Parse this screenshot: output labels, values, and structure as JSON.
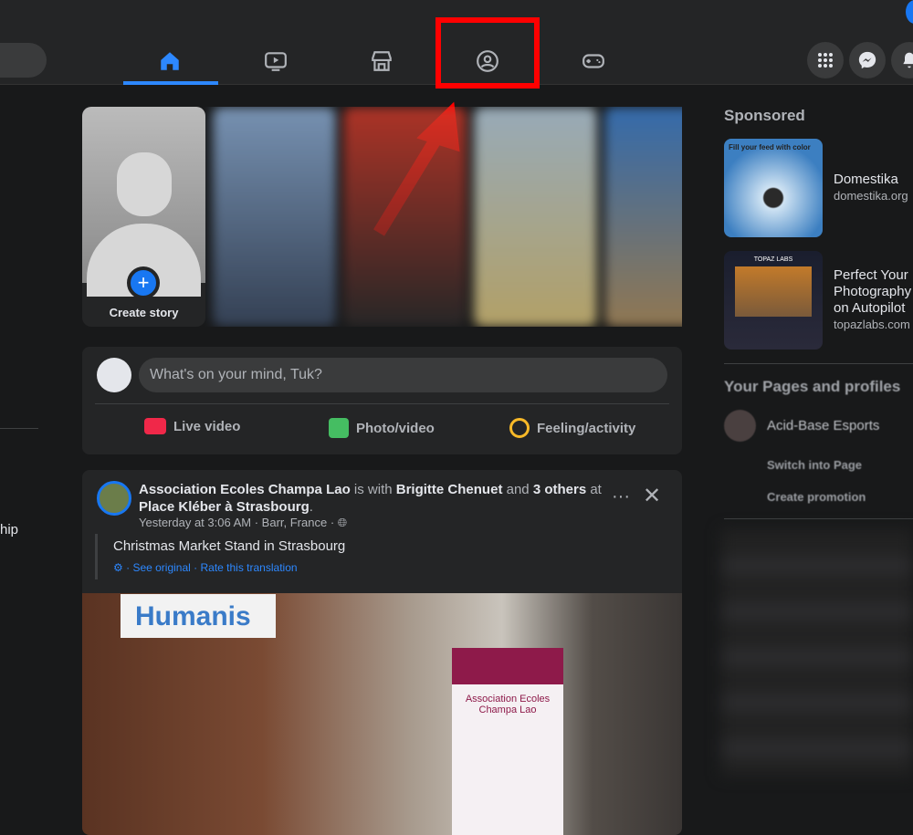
{
  "nav": {
    "tabs": [
      "home-icon",
      "watch-icon",
      "marketplace-icon",
      "groups-icon",
      "gaming-icon"
    ],
    "active": "home",
    "right_buttons": [
      "menu-grid-icon",
      "messenger-icon",
      "notifications-icon"
    ]
  },
  "left_sidebar": {
    "partial_text": "hip"
  },
  "stories": {
    "create_label": "Create story"
  },
  "composer": {
    "placeholder": "What's on your mind, Tuk?",
    "actions": [
      {
        "label": "Live video",
        "color": "#f02849"
      },
      {
        "label": "Photo/video",
        "color": "#45bd62"
      },
      {
        "label": "Feeling/activity",
        "color": "#f7b928"
      }
    ]
  },
  "post": {
    "author": "Association Ecoles Champa Lao",
    "with_text": "is with",
    "tagged": "Brigitte Chenuet",
    "and_text": "and",
    "others": "3 others",
    "at_text": "at",
    "place": "Place Kléber à Strasbourg",
    "time": "Yesterday at 3:06 AM",
    "location": "Barr, France",
    "text": "Christmas Market Stand in Strasbourg",
    "see_original": "See original",
    "rate_translation": "Rate this translation",
    "image_sign": "Humanis",
    "image_banner": "Association Ecoles Champa Lao"
  },
  "sponsored": {
    "heading": "Sponsored",
    "ads": [
      {
        "title": "Domestika",
        "url": "domestika.org",
        "image_caption": "Fill your feed with color"
      },
      {
        "title": "Perfect Your Photography on Autopilot",
        "url": "topazlabs.com",
        "image_caption": "TOPAZ LABS"
      }
    ]
  },
  "pages": {
    "heading": "Your Pages and profiles",
    "page_name": "Acid-Base Esports",
    "switch": "Switch into Page",
    "promotion": "Create promotion"
  },
  "annotation": {
    "color": "#ff0000",
    "target": "groups-tab"
  }
}
